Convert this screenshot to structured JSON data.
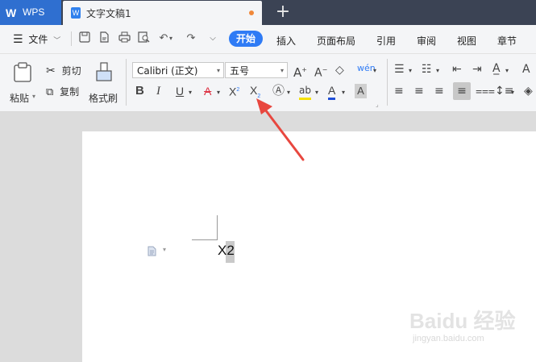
{
  "tabs": {
    "app_logo": "W",
    "app_label": "WPS",
    "doc_icon_letter": "W",
    "doc_title": "文字文稿1",
    "new_tab": "+"
  },
  "menu": {
    "file_label": "文件",
    "items": [
      "开始",
      "插入",
      "页面布局",
      "引用",
      "审阅",
      "视图",
      "章节"
    ]
  },
  "ribbon": {
    "paste_label": "粘贴",
    "cut_label": "剪切",
    "copy_label": "复制",
    "format_painter_label": "格式刷",
    "font_name": "Calibri (正文)",
    "font_size": "五号"
  },
  "document": {
    "text": "X2"
  },
  "colors": {
    "accent": "#2f7bf5",
    "annotation_arrow": "#e8473f",
    "titlebar": "#3b4354"
  },
  "watermark": {
    "brand": "Baidu 经验",
    "url": "jingyan.baidu.com"
  }
}
